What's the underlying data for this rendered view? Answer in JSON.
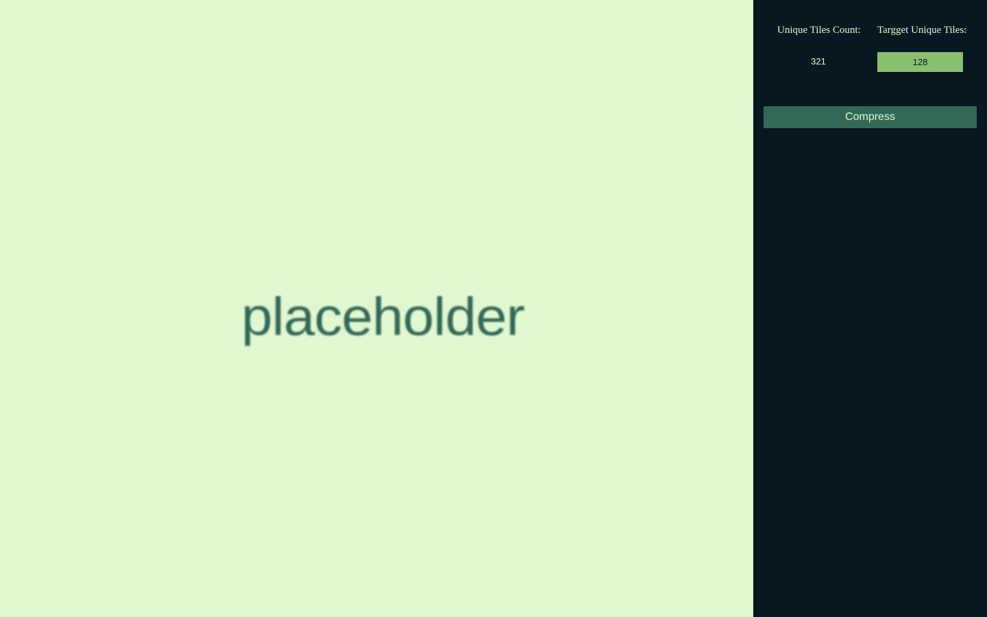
{
  "canvas": {
    "image_text": "placeholder"
  },
  "sidebar": {
    "unique_tiles_label": "Unique Tiles Count:",
    "unique_tiles_value": "321",
    "target_tiles_label": "Targget Unique Tiles:",
    "target_tiles_value": "128",
    "compress_label": "Compress"
  },
  "colors": {
    "lightest": "#e0f8d0",
    "light": "#88c070",
    "dark": "#346856",
    "darkest": "#081820"
  }
}
